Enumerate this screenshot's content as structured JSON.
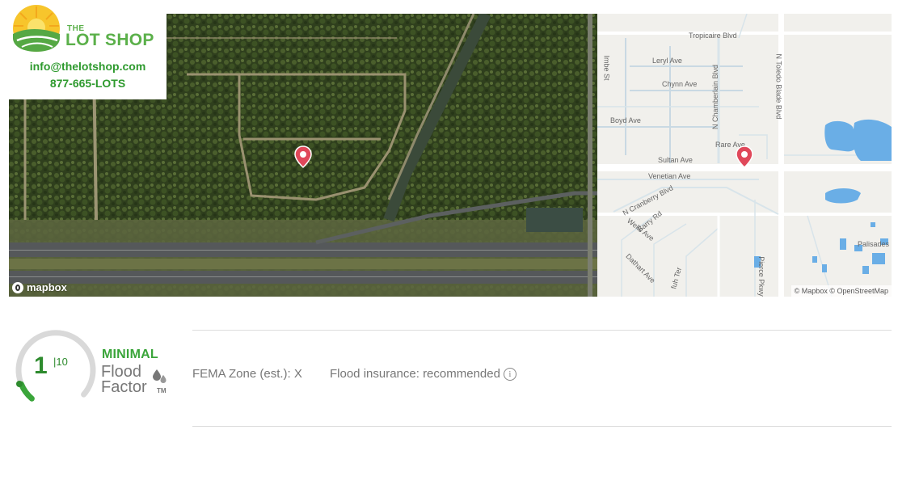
{
  "logo": {
    "the": "THE",
    "name": "LOT SHOP",
    "email": "info@thelotshop.com",
    "phone": "877-665-LOTS"
  },
  "satellite_map": {
    "logo_text": "mapbox"
  },
  "street_map": {
    "attribution": "© Mapbox © OpenStreetMap",
    "labels": {
      "tropicaire": "Tropicaire Blvd",
      "imbe": "Imbe St",
      "leryl": "Leryl Ave",
      "chynn": "Chynn Ave",
      "chamberlain": "N Chamberlain Blvd",
      "toledo": "N Toledo Blade Blvd",
      "boyd": "Boyd Ave",
      "rare": "Rare Ave",
      "sultan": "Sultan Ave",
      "venetian": "Venetian Ave",
      "cranberry": "N Cranberry Blvd",
      "barry": "Barry Rd",
      "wells": "Wells Ave",
      "dathart": "Dathart Ave",
      "pierce": "Pierce Pkwy",
      "fuh": "fuh Ter",
      "palisades": "Palisades Blv"
    }
  },
  "flood": {
    "score": "1",
    "out_of": "|10",
    "level": "MINIMAL",
    "brand_line1": "Flood",
    "brand_line2": "Factor",
    "trademark": "TM",
    "fema_zone": "FEMA Zone (est.): X",
    "insurance": "Flood insurance: recommended",
    "info_glyph": "i",
    "gauge_fraction": 0.1
  },
  "colors": {
    "brand_green": "#2e9a2e",
    "logo_green": "#5bb04a",
    "pin_red": "#e0485a",
    "water_blue": "#6aaee6"
  },
  "icons": {
    "pin": "map-pin-icon",
    "info": "info-icon",
    "drops": "water-drops-icon",
    "sun": "sun-field-logo-icon"
  }
}
